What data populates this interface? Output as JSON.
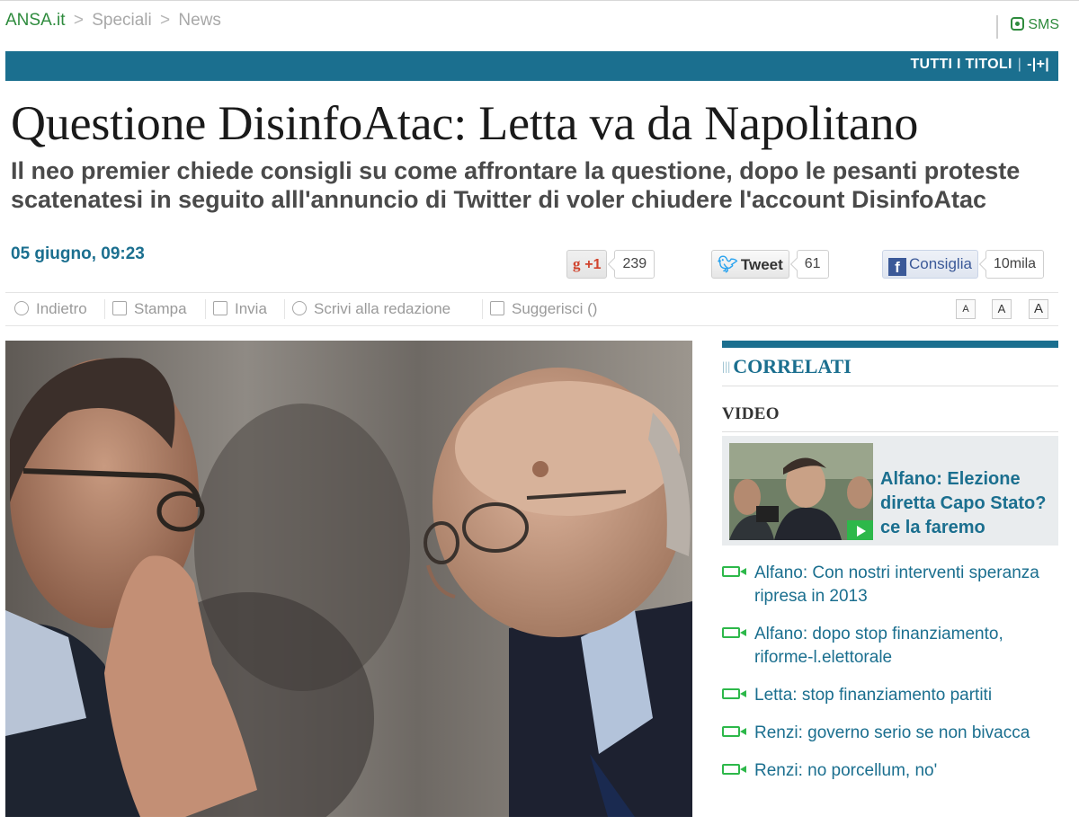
{
  "breadcrumb": {
    "home": "ANSA.it",
    "sep1": ">",
    "item1": "Speciali",
    "sep2": ">",
    "item2": "News"
  },
  "topbar": {
    "sms_label": "SMS",
    "tutti_titoli": "TUTTI I TITOLI",
    "tutti_sep": "|",
    "tutti_icon": "-|+|"
  },
  "article": {
    "headline": "Questione DisinfoAtac: Letta va da Napolitano",
    "subtitle": "Il neo premier chiede consigli su come affrontare la questione, dopo le pesanti proteste scatenatesi in seguito alll'annuncio di Twitter di voler chiudere l'account DisinfoAtac",
    "date": "05 giugno, 09:23"
  },
  "social": {
    "gplus_g": "g",
    "gplus_label": "+1",
    "gplus_count": "239",
    "tweet_label": "Tweet",
    "tweet_count": "61",
    "fb_f": "f",
    "fb_label": "Consiglia",
    "fb_count": "10mila"
  },
  "toolbar": {
    "indietro": "Indietro",
    "stampa": "Stampa",
    "invia": "Invia",
    "scrivi": "Scrivi alla redazione",
    "suggerisci": "Suggerisci ()",
    "font_smaller": "A",
    "font_normal": "A",
    "font_larger": "A"
  },
  "sidebar": {
    "correlati_icon": "|||",
    "correlati": "CORRELATI",
    "video_heading": "VIDEO",
    "feature_title": "Alfano: Elezione diretta Capo Stato? ce la faremo",
    "videos": [
      "Alfano: Con nostri interventi speranza ripresa in 2013",
      "Alfano: dopo stop finanziamento, riforme-l.elettorale",
      "Letta: stop finanziamento partiti",
      "Renzi: governo serio se non bivacca",
      "Renzi: no porcellum, no'"
    ]
  },
  "colors": {
    "brand_blue": "#1b6f8f",
    "ansa_green": "#2e8b3d",
    "video_green": "#2db84a"
  },
  "icons": {
    "sms": "sms-icon",
    "tutti": "expand-icon",
    "indietro": "back-icon",
    "stampa": "print-icon",
    "invia": "mail-icon",
    "scrivi": "edit-icon",
    "suggerisci": "comment-icon",
    "play": "play-icon",
    "video": "video-camera-icon"
  }
}
